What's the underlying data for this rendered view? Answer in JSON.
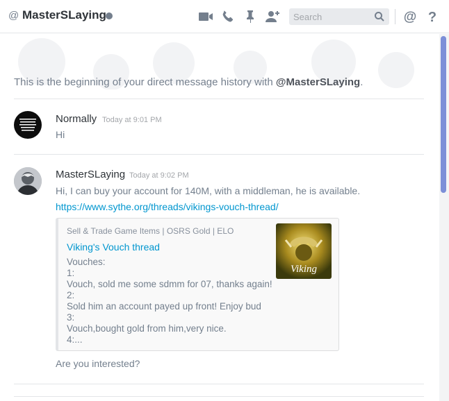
{
  "header": {
    "at_symbol": "@",
    "username": "MasterSLaying",
    "status": "offline",
    "icons": [
      "video-call-icon",
      "voice-call-icon",
      "pin-icon",
      "add-friend-icon"
    ],
    "search_placeholder": "Search",
    "mentions_symbol": "@",
    "help_symbol": "?"
  },
  "intro": {
    "prefix": "This is the beginning of your direct message history with ",
    "name": "@MasterSLaying",
    "suffix": "."
  },
  "messages": [
    {
      "author": "Normally",
      "timestamp": "Today at 9:01 PM",
      "lines": [
        "Hi"
      ]
    },
    {
      "author": "MasterSLaying",
      "timestamp": "Today at 9:02 PM",
      "lines": [
        "Hi, I can buy your account for 140M, with a middleman, he is available."
      ],
      "link": "https://www.sythe.org/threads/vikings-vouch-thread/",
      "embed": {
        "provider": "Sell & Trade Game Items | OSRS Gold | ELO",
        "title": "Viking's Vouch thread",
        "description": [
          "Vouches:",
          "1:",
          "Vouch, sold me some sdmm for 07, thanks again!",
          "2:",
          "Sold him an account payed up front! Enjoy bud",
          "3:",
          "Vouch,bought gold from him,very nice.",
          "4:..."
        ],
        "thumbnail_text": "Viking"
      },
      "followup": "Are you interested?"
    }
  ],
  "colors": {
    "accent_link": "#0096cf",
    "scrollbar": "#7c8fd8",
    "muted": "#737f8d"
  }
}
